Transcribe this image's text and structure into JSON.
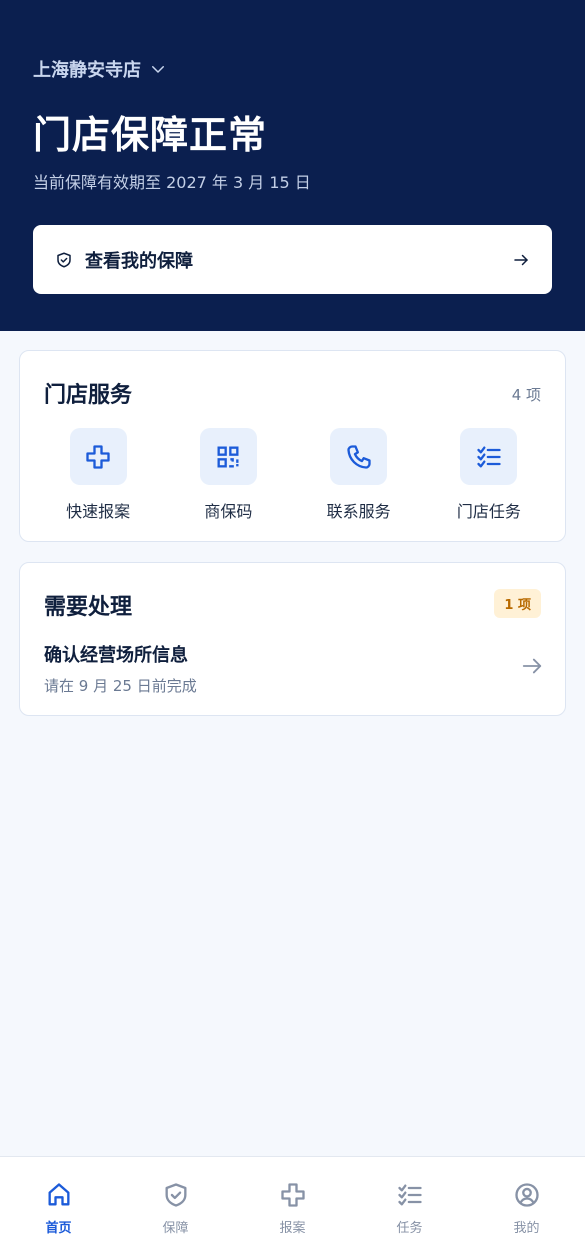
{
  "header": {
    "store_name": "上海静安寺店",
    "status_title": "门店保障正常",
    "valid_text": "当前保障有效期至 2027 年 3 月 15 日",
    "view_button_label": "查看我的保障"
  },
  "services": {
    "title": "门店服务",
    "count": "4 项",
    "items": [
      {
        "label": "快速报案",
        "icon": "plus-cross-icon"
      },
      {
        "label": "商保码",
        "icon": "qr-code-icon"
      },
      {
        "label": "联系服务",
        "icon": "phone-icon"
      },
      {
        "label": "门店任务",
        "icon": "checklist-icon"
      }
    ]
  },
  "todo": {
    "title": "需要处理",
    "badge": "1 项",
    "item_title": "确认经营场所信息",
    "item_sub": "请在 9 月 25 日前完成"
  },
  "tabbar": {
    "items": [
      {
        "label": "首页",
        "icon": "home-icon",
        "active": true
      },
      {
        "label": "保障",
        "icon": "shield-check-icon",
        "active": false
      },
      {
        "label": "报案",
        "icon": "plus-cross-icon",
        "active": false
      },
      {
        "label": "任务",
        "icon": "checklist-icon",
        "active": false
      },
      {
        "label": "我的",
        "icon": "user-circle-icon",
        "active": false
      }
    ]
  },
  "colors": {
    "header_bg": "#0b1f4f",
    "accent": "#1c5bd9",
    "badge_bg": "#fff1d6",
    "badge_text": "#b86a00"
  }
}
